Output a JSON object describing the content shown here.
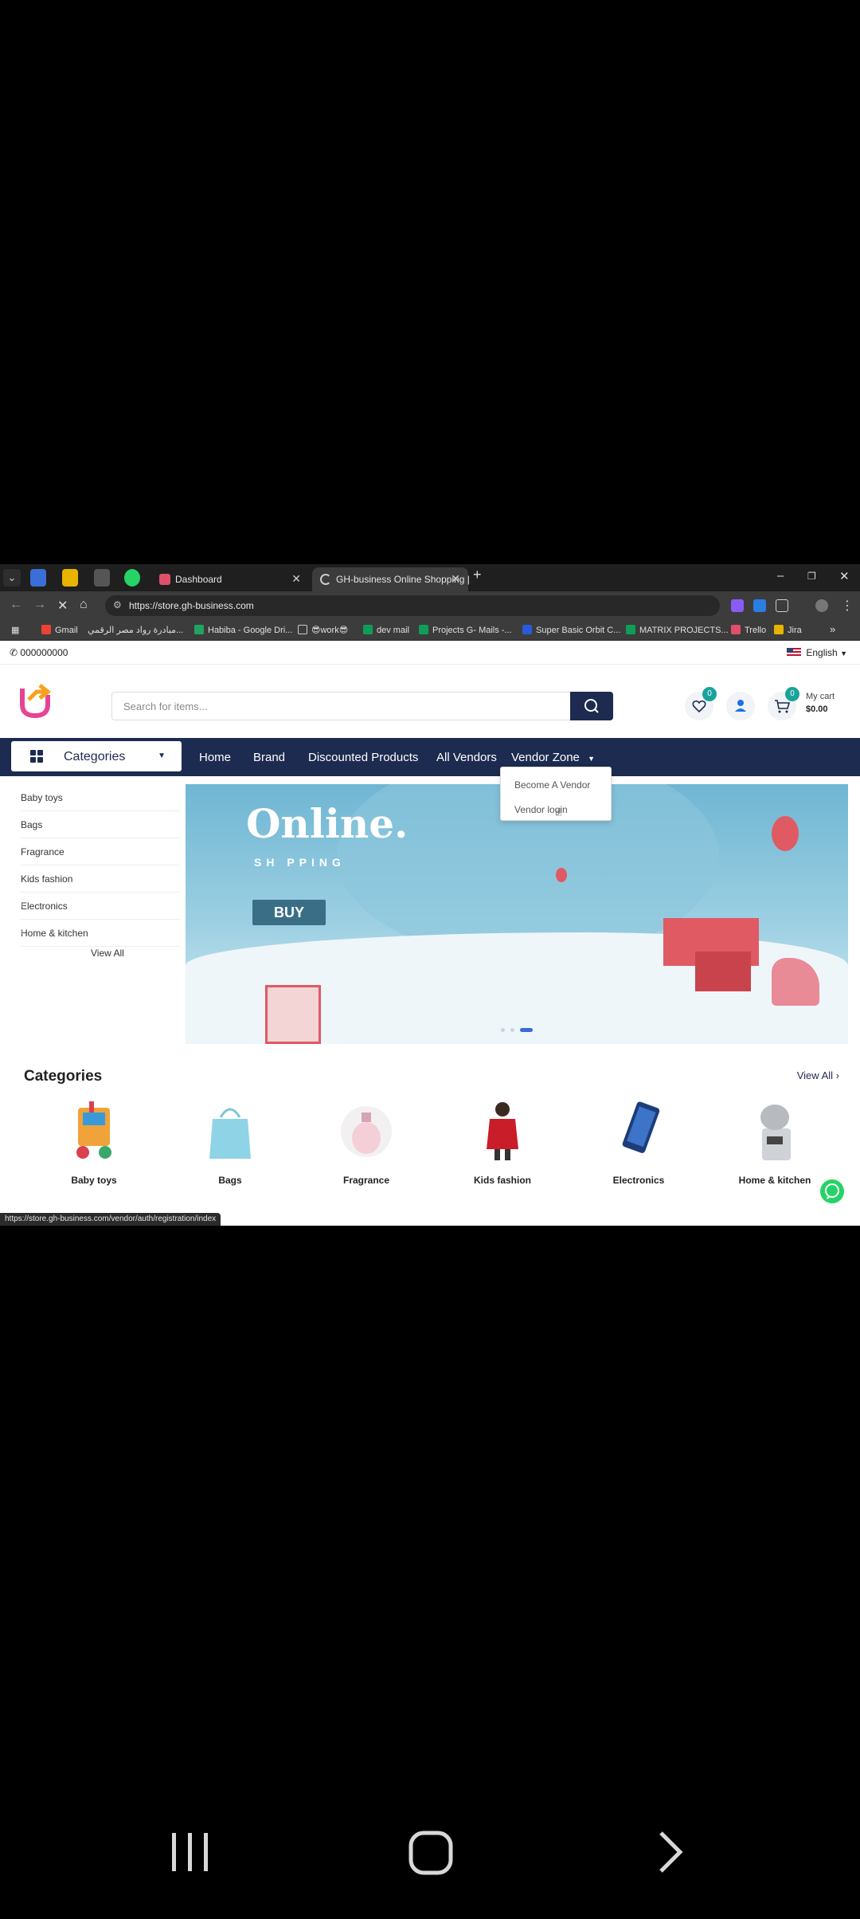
{
  "browser": {
    "tabs": [
      {
        "title": "Dashboard"
      },
      {
        "title": "GH-business Online Shopping |"
      }
    ],
    "url": "https://store.gh-business.com",
    "bookmarks": [
      "Gmail",
      "مبادرة رواد مصر الرقمي...",
      "Habiba - Google Dri...",
      "😎work😎",
      "dev mail",
      "Projects G- Mails -...",
      "Super Basic Orbit C...",
      "MATRIX PROJECTS...",
      "Trello",
      "Jira"
    ],
    "status_url": "https://store.gh-business.com/vendor/auth/registration/index"
  },
  "topbar": {
    "phone": "000000000",
    "language": "English"
  },
  "header": {
    "search_placeholder": "Search for items...",
    "wishlist_count": "0",
    "cart_count": "0",
    "cart_label": "My cart",
    "cart_total": "$0.00"
  },
  "nav": {
    "categories_label": "Categories",
    "links": [
      "Home",
      "Brand",
      "Discounted Products",
      "All Vendors",
      "Vendor Zone"
    ]
  },
  "vendor_dropdown": {
    "items": [
      "Become A Vendor",
      "Vendor login"
    ]
  },
  "side_categories": {
    "items": [
      {
        "label": "Baby toys"
      },
      {
        "label": "Bags"
      },
      {
        "label": "Fragrance"
      },
      {
        "label": "Kids fashion"
      },
      {
        "label": "Electronics"
      },
      {
        "label": "Home & kitchen"
      }
    ],
    "view_all": "View All"
  },
  "banner": {
    "headline": "Online.",
    "subline": "SH  PPING",
    "button": "BUY"
  },
  "categories_section": {
    "title": "Categories",
    "view_all": "View All",
    "items": [
      "Baby toys",
      "Bags",
      "Fragrance",
      "Kids fashion",
      "Electronics",
      "Home & kitchen"
    ]
  },
  "colors": {
    "navy": "#1c2b4f",
    "teal_badge": "#1aa39a",
    "whatsapp": "#25d366"
  }
}
